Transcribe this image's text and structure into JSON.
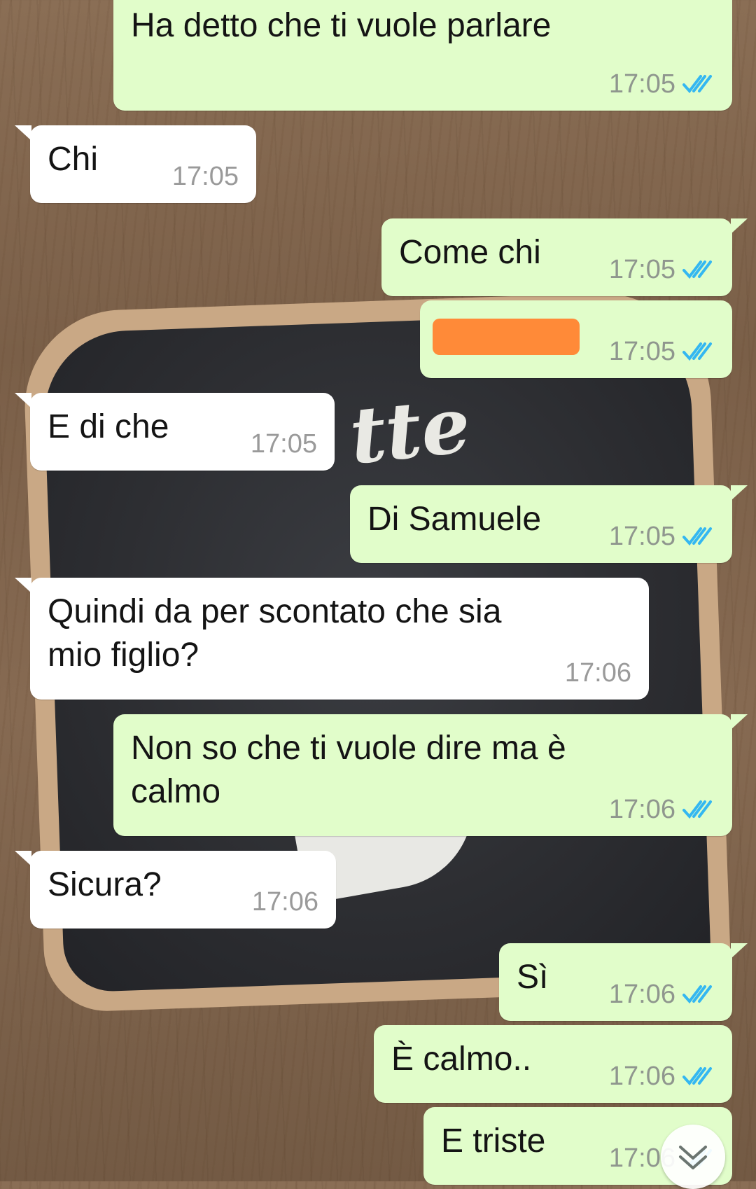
{
  "theme": {
    "outgoing_bubble": "#e1fdca",
    "incoming_bubble": "#ffffff",
    "read_tick_color": "#34b7f1"
  },
  "wallpaper": {
    "chalk_text": "tte"
  },
  "messages": [
    {
      "direction": "outgoing",
      "text": "Ha detto che ti vuole parlare",
      "time": "17:05",
      "status": "read",
      "status_icon": "double-check-icon"
    },
    {
      "direction": "incoming",
      "text": "Chi",
      "time": "17:05"
    },
    {
      "direction": "outgoing",
      "text": "Come chi",
      "time": "17:05",
      "status": "read",
      "status_icon": "double-check-icon"
    },
    {
      "direction": "outgoing",
      "text": "",
      "redacted": true,
      "time": "17:05",
      "status": "read",
      "status_icon": "double-check-icon"
    },
    {
      "direction": "incoming",
      "text": "E di che",
      "time": "17:05"
    },
    {
      "direction": "outgoing",
      "text": "Di Samuele",
      "time": "17:05",
      "status": "read",
      "status_icon": "double-check-icon"
    },
    {
      "direction": "incoming",
      "text": "Quindi da per scontato che sia\nmio figlio?",
      "time": "17:06"
    },
    {
      "direction": "outgoing",
      "text": "Non so che ti vuole dire ma è\ncalmo",
      "time": "17:06",
      "status": "read",
      "status_icon": "double-check-icon"
    },
    {
      "direction": "incoming",
      "text": "Sicura?",
      "time": "17:06"
    },
    {
      "direction": "outgoing",
      "text": "Sì",
      "time": "17:06",
      "status": "read",
      "status_icon": "double-check-icon"
    },
    {
      "direction": "outgoing",
      "text": "È calmo..",
      "time": "17:06",
      "status": "read",
      "status_icon": "double-check-icon"
    },
    {
      "direction": "outgoing",
      "text": "E triste",
      "time": "17:06",
      "status": "read",
      "status_icon": "double-check-icon"
    }
  ],
  "scroll_button": {
    "icon": "double-chevron-down-icon"
  }
}
